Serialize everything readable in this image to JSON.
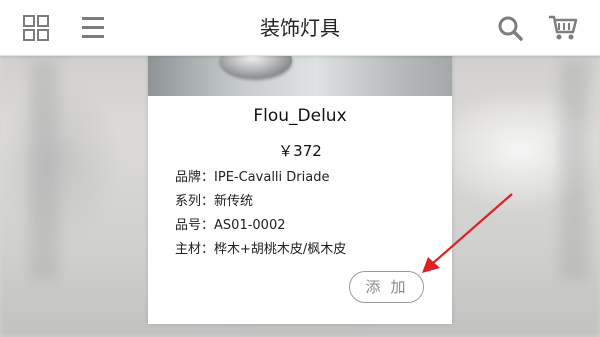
{
  "header": {
    "title": "装饰灯具",
    "icons": [
      "grid-icon",
      "menu-icon",
      "search-icon",
      "cart-icon"
    ]
  },
  "product": {
    "name": "Flou_Delux",
    "price": "￥372",
    "specs": [
      {
        "key": "品牌",
        "value": "IPE-Cavalli Driade"
      },
      {
        "key": "系列",
        "value": "新传统"
      },
      {
        "key": "品号",
        "value": "AS01-0002"
      },
      {
        "key": "主材",
        "value": "桦木+胡桃木皮/枫木皮"
      }
    ],
    "add_label": "添加"
  },
  "colors": {
    "header_bg": "#ffffff",
    "icon_gray": "#7d7d7d",
    "annotation_arrow": "#e02020"
  }
}
